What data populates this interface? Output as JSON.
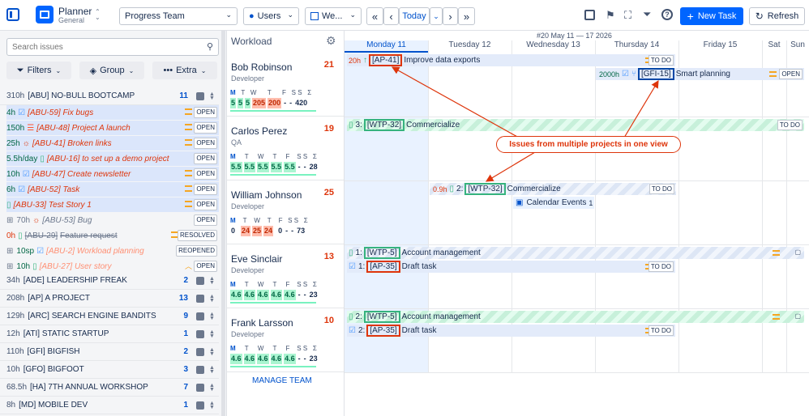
{
  "app": {
    "title": "Planner",
    "subtitle": "General"
  },
  "toolbar": {
    "team": "Progress Team",
    "users": "Users",
    "week": "We...",
    "today": "Today",
    "new_task": "New Task",
    "refresh": "Refresh"
  },
  "sidebar": {
    "search_placeholder": "Search issues",
    "filters": "Filters",
    "group": "Group",
    "extra": "Extra",
    "project_abu": {
      "hours": "310h",
      "name": "[ABU] NO-BULL BOOTCAMP",
      "count": "11"
    },
    "issues": [
      {
        "hours": "4h",
        "key": "[ABU-59]",
        "title": "Fix bugs",
        "status": "OPEN"
      },
      {
        "hours": "150h",
        "key": "[ABU-48]",
        "title": "Project A launch",
        "status": "OPEN"
      },
      {
        "hours": "25h",
        "key": "[ABU-41]",
        "title": "Broken links",
        "status": "OPEN"
      },
      {
        "hours": "5.5h/day",
        "key": "[ABU-16]",
        "title": "to set up a demo project",
        "status": "OPEN"
      },
      {
        "hours": "10h",
        "key": "[ABU-47]",
        "title": "Create newsletter",
        "status": "OPEN"
      },
      {
        "hours": "6h",
        "key": "[ABU-52]",
        "title": "Task",
        "status": "OPEN"
      },
      {
        "hours": "",
        "key": "[ABU-33]",
        "title": "Test Story 1",
        "status": "OPEN"
      },
      {
        "hours": "70h",
        "key": "[ABU-53]",
        "title": "Bug",
        "status": "OPEN"
      },
      {
        "hours": "0h",
        "key": "[ABU-29]",
        "title": "Feature request",
        "status": "RESOLVED"
      },
      {
        "hours": "10sp",
        "key": "[ABU-2]",
        "title": "Workload planning",
        "status": "REOPENED"
      },
      {
        "hours": "10h",
        "key": "[ABU-27]",
        "title": "User story",
        "status": "OPEN"
      }
    ],
    "projects": [
      {
        "hours": "34h",
        "name": "[ADE] LEADERSHIP FREAK",
        "count": "2"
      },
      {
        "hours": "208h",
        "name": "[AP] A PROJECT",
        "count": "13"
      },
      {
        "hours": "129h",
        "name": "[ARC] SEARCH ENGINE BANDITS",
        "count": "9"
      },
      {
        "hours": "12h",
        "name": "[ATI] STATIC STARTUP",
        "count": "1"
      },
      {
        "hours": "110h",
        "name": "[GFI] BIGFISH",
        "count": "2"
      },
      {
        "hours": "10h",
        "name": "[GFO] BIGFOOT",
        "count": "3"
      },
      {
        "hours": "68.5h",
        "name": "[HA] 7TH ANNUAL WORKSHOP",
        "count": "7"
      },
      {
        "hours": "8h",
        "name": "[MD] MOBILE DEV",
        "count": "1"
      }
    ]
  },
  "workload": {
    "title": "Workload",
    "manage_team": "MANAGE TEAM",
    "day_letters": [
      "M",
      "T",
      "W",
      "T",
      "F",
      "S",
      "S",
      "Σ"
    ],
    "people": [
      {
        "name": "Bob Robinson",
        "role": "Developer",
        "count": "21",
        "values": [
          "5",
          "5",
          "5",
          "205",
          "200",
          "-",
          "-",
          "420"
        ]
      },
      {
        "name": "Carlos Perez",
        "role": "QA",
        "count": "19",
        "values": [
          "5.5",
          "5.5",
          "5.5",
          "5.5",
          "5.5",
          "-",
          "-",
          "28"
        ]
      },
      {
        "name": "William Johnson",
        "role": "Developer",
        "count": "25",
        "values": [
          "0",
          "24",
          "25",
          "24",
          "0",
          "-",
          "-",
          "73"
        ]
      },
      {
        "name": "Eve Sinclair",
        "role": "Developer",
        "count": "13",
        "values": [
          "4.6",
          "4.6",
          "4.6",
          "4.6",
          "4.6",
          "-",
          "-",
          "23"
        ]
      },
      {
        "name": "Frank Larsson",
        "role": "Developer",
        "count": "10",
        "values": [
          "4.6",
          "4.6",
          "4.6",
          "4.6",
          "4.6",
          "-",
          "-",
          "23"
        ]
      }
    ]
  },
  "calendar": {
    "week_label": "#20 May 11 — 17 2026",
    "days": [
      "Monday 11",
      "Tuesday 12",
      "Wednesday 13",
      "Thursday 14",
      "Friday 15",
      "Sat",
      "Sun"
    ],
    "bars": {
      "b1": {
        "hours": "20h",
        "key": "[AP-41]",
        "title": "Improve data exports",
        "status": "TO DO"
      },
      "b2": {
        "hours": "2000h",
        "key": "[GFI-15]",
        "title": "Smart planning",
        "status": "OPEN"
      },
      "b3": {
        "prefix": "3:",
        "key": "[WTP-32]",
        "title": "Commercialize",
        "status": "TO DO"
      },
      "b4": {
        "hours": "0.9h",
        "prefix": "2:",
        "key": "[WTP-32]",
        "title": "Commercialize",
        "status": "TO DO"
      },
      "b5": {
        "title": "Calendar Events",
        "count": "1"
      },
      "b6": {
        "prefix": "1:",
        "key": "[WTP-5]",
        "title": "Account management"
      },
      "b7": {
        "prefix": "1:",
        "key": "[AP-35]",
        "title": "Draft task",
        "status": "TO DO"
      },
      "b8": {
        "prefix": "2:",
        "key": "[WTP-5]",
        "title": "Account management"
      },
      "b9": {
        "prefix": "2:",
        "key": "[AP-35]",
        "title": "Draft task",
        "status": "TO DO"
      }
    },
    "callout": "Issues from multiple projects in one view"
  }
}
